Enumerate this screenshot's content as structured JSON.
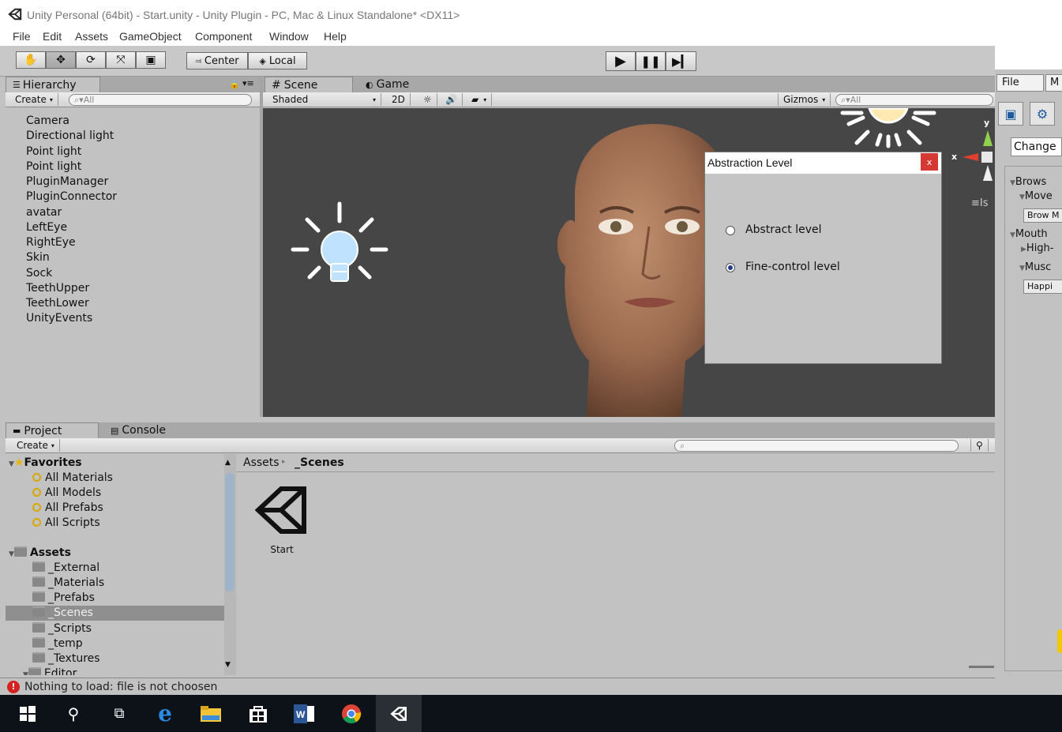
{
  "window": {
    "title": "Unity Personal (64bit) - Start.unity - Unity Plugin - PC, Mac & Linux Standalone* <DX11>"
  },
  "menu": [
    "File",
    "Edit",
    "Assets",
    "GameObject",
    "Component",
    "Window",
    "Help"
  ],
  "toolbar": {
    "center_label": "Center",
    "local_label": "Local"
  },
  "hierarchy": {
    "tab_label": "Hierarchy",
    "create_label": "Create",
    "search_placeholder": "All",
    "items": [
      "Camera",
      "Directional light",
      "Point light",
      "Point light",
      "PluginManager",
      "PluginConnector",
      "avatar",
      "LeftEye",
      "RightEye",
      "Skin",
      "Sock",
      "TeethUpper",
      "TeethLower",
      "UnityEvents"
    ]
  },
  "scene": {
    "tab_scene": "Scene",
    "tab_game": "Game",
    "shading": "Shaded",
    "mode_2d": "2D",
    "gizmos": "Gizmos",
    "search_placeholder": "All",
    "axis_y": "y",
    "axis_x": "x",
    "persp_label": "Is"
  },
  "dialog": {
    "title": "Abstraction Level",
    "close": "x",
    "options": [
      {
        "label": "Abstract level",
        "selected": false
      },
      {
        "label": "Fine-control level",
        "selected": true
      }
    ]
  },
  "right_panel": {
    "file": "File",
    "m": "M",
    "change": "Change",
    "brows": "Brows",
    "move": "Move",
    "brow_btn": "Brow M",
    "mouth": "Mouth",
    "high": "High-",
    "musc": "Musc",
    "happi": "Happi"
  },
  "project": {
    "tab_project": "Project",
    "tab_console": "Console",
    "create_label": "Create",
    "favorites_label": "Favorites",
    "favorites": [
      "All Materials",
      "All Models",
      "All Prefabs",
      "All Scripts"
    ],
    "assets_label": "Assets",
    "folders": [
      "_External",
      "_Materials",
      "_Prefabs",
      "_Scenes",
      "_Scripts",
      "_temp",
      "_Textures",
      "Editor"
    ],
    "selected_folder": "_Scenes",
    "breadcrumb_root": "Assets",
    "breadcrumb_current": "_Scenes",
    "files": [
      "Start"
    ]
  },
  "status": {
    "message": "Nothing to load: file is not choosen"
  },
  "colors": {
    "scene_bg": "#464646",
    "selection": "#8f8f8f",
    "close_button": "#d43a33",
    "taskbar": "#0c1218"
  }
}
